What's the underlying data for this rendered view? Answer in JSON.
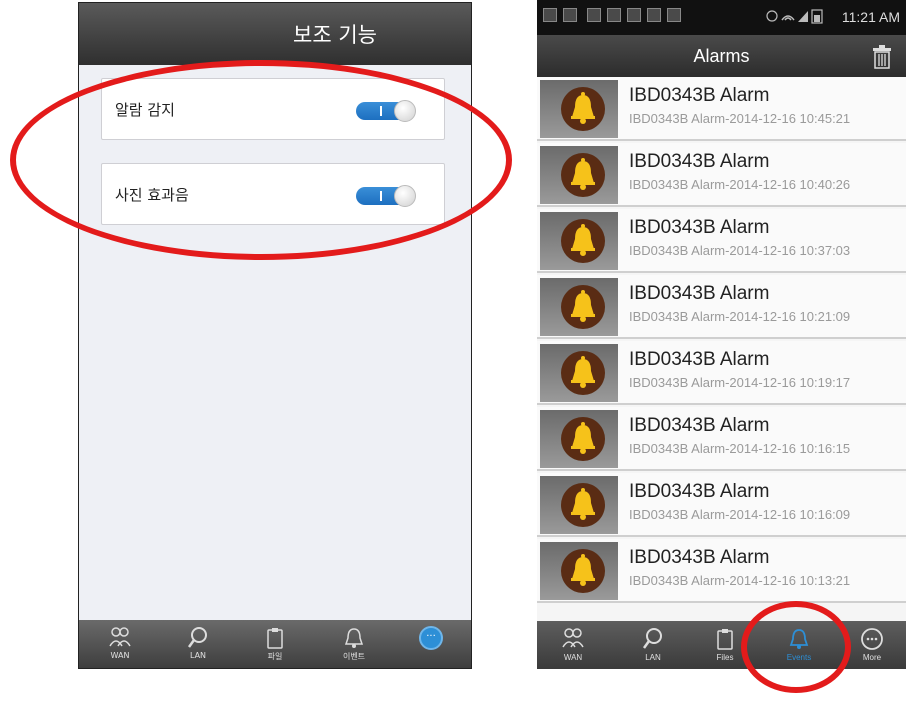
{
  "left": {
    "title": "보조 기능",
    "settings": [
      {
        "label": "알람 감지",
        "on": true
      },
      {
        "label": "사진 효과음",
        "on": true
      }
    ],
    "nav": [
      {
        "label": "WAN",
        "icon": "people-icon"
      },
      {
        "label": "LAN",
        "icon": "search-icon"
      },
      {
        "label": "파일",
        "icon": "clipboard-icon"
      },
      {
        "label": "이벤트",
        "icon": "bell-icon"
      },
      {
        "label": "",
        "icon": "more-icon",
        "active": true
      }
    ]
  },
  "right": {
    "status": {
      "time": "11:21 AM"
    },
    "title": "Alarms",
    "alarms": [
      {
        "title": "IBD0343B Alarm",
        "subtitle": "IBD0343B Alarm-2014-12-16 10:45:21"
      },
      {
        "title": "IBD0343B Alarm",
        "subtitle": "IBD0343B Alarm-2014-12-16 10:40:26"
      },
      {
        "title": "IBD0343B Alarm",
        "subtitle": "IBD0343B Alarm-2014-12-16 10:37:03"
      },
      {
        "title": "IBD0343B Alarm",
        "subtitle": "IBD0343B Alarm-2014-12-16 10:21:09"
      },
      {
        "title": "IBD0343B Alarm",
        "subtitle": "IBD0343B Alarm-2014-12-16 10:19:17"
      },
      {
        "title": "IBD0343B Alarm",
        "subtitle": "IBD0343B Alarm-2014-12-16 10:16:15"
      },
      {
        "title": "IBD0343B Alarm",
        "subtitle": "IBD0343B Alarm-2014-12-16 10:16:09"
      },
      {
        "title": "IBD0343B Alarm",
        "subtitle": "IBD0343B Alarm-2014-12-16 10:13:21"
      }
    ],
    "nav": [
      {
        "label": "WAN",
        "icon": "people-icon"
      },
      {
        "label": "LAN",
        "icon": "search-icon"
      },
      {
        "label": "Files",
        "icon": "clipboard-icon"
      },
      {
        "label": "Events",
        "icon": "bell-icon",
        "active": true
      },
      {
        "label": "More",
        "icon": "more-icon"
      }
    ]
  },
  "colors": {
    "accent": "#1d6fc0",
    "annotation": "#e31b1b",
    "bell": "#f6c21a"
  }
}
